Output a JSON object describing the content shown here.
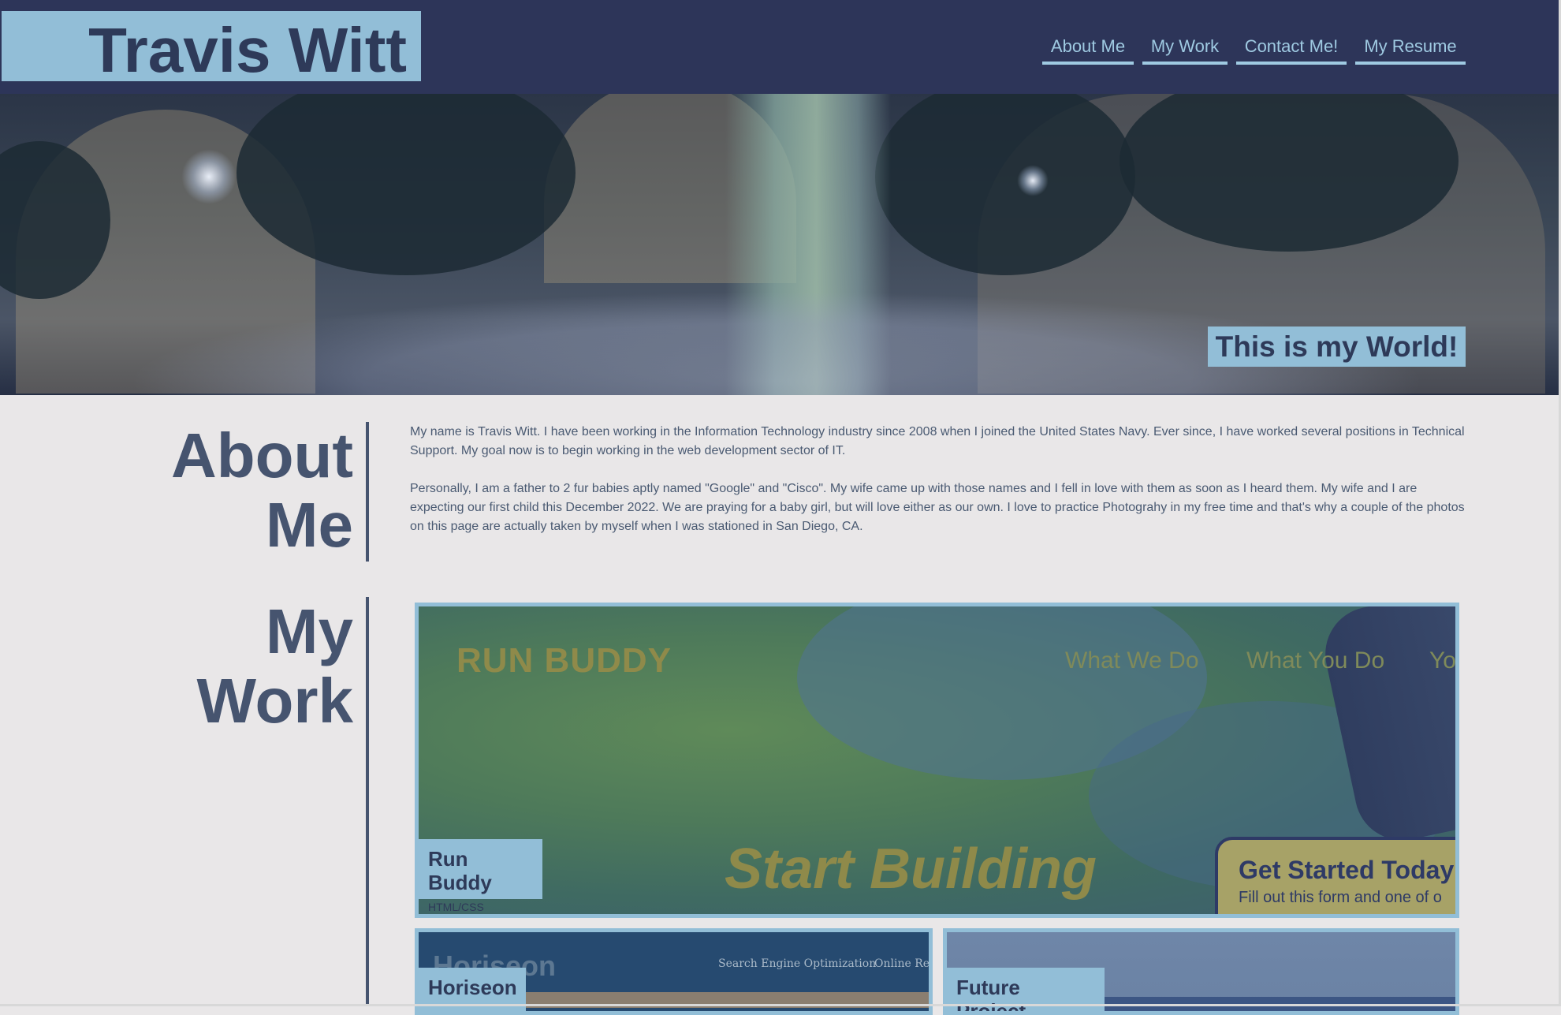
{
  "header": {
    "site_name": "Travis Witt",
    "nav": [
      {
        "label": "About Me"
      },
      {
        "label": "My Work"
      },
      {
        "label": "Contact Me!"
      },
      {
        "label": "My Resume"
      }
    ]
  },
  "hero": {
    "tagline": "This is my World!"
  },
  "about": {
    "title_line1": "About",
    "title_line2": "Me",
    "paragraph1": "My name is Travis Witt. I have been working in the Information Technology industry since 2008 when I joined the United States Navy. Ever since, I have worked several positions in Technical Support. My goal now is to begin working in the web development sector of IT.",
    "paragraph2": "Personally, I am a father to 2 fur babies aptly named \"Google\" and \"Cisco\". My wife came up with those names and I fell in love with them as soon as I heard them. My wife and I are expecting our first child this December 2022. We are praying for a baby girl, but will love either as our own. I love to practice Photograhy in my free time and that's why a couple of the photos on this page are actually taken by myself when I was stationed in San Diego, CA."
  },
  "work": {
    "title_line1": "My",
    "title_line2": "Work",
    "projects": [
      {
        "title": "Run Buddy",
        "subtitle": "HTML/CSS",
        "preview": {
          "brand": "RUN BUDDY",
          "nav": [
            "What We Do",
            "What You Do",
            "Yo"
          ],
          "headline": "Start Building",
          "cta_title": "Get Started Today",
          "cta_sub": "Fill out this form and one of o"
        }
      },
      {
        "title": "Horiseon",
        "preview": {
          "brand": "Horiseon",
          "nav": [
            "Search Engine Optimization",
            "Online Rep"
          ]
        }
      },
      {
        "title": "Future Project"
      }
    ]
  },
  "colors": {
    "header_bg": "#2d3559",
    "accent": "#92bed7",
    "heading": "#46546f",
    "page_bg": "#e9e7e8"
  }
}
